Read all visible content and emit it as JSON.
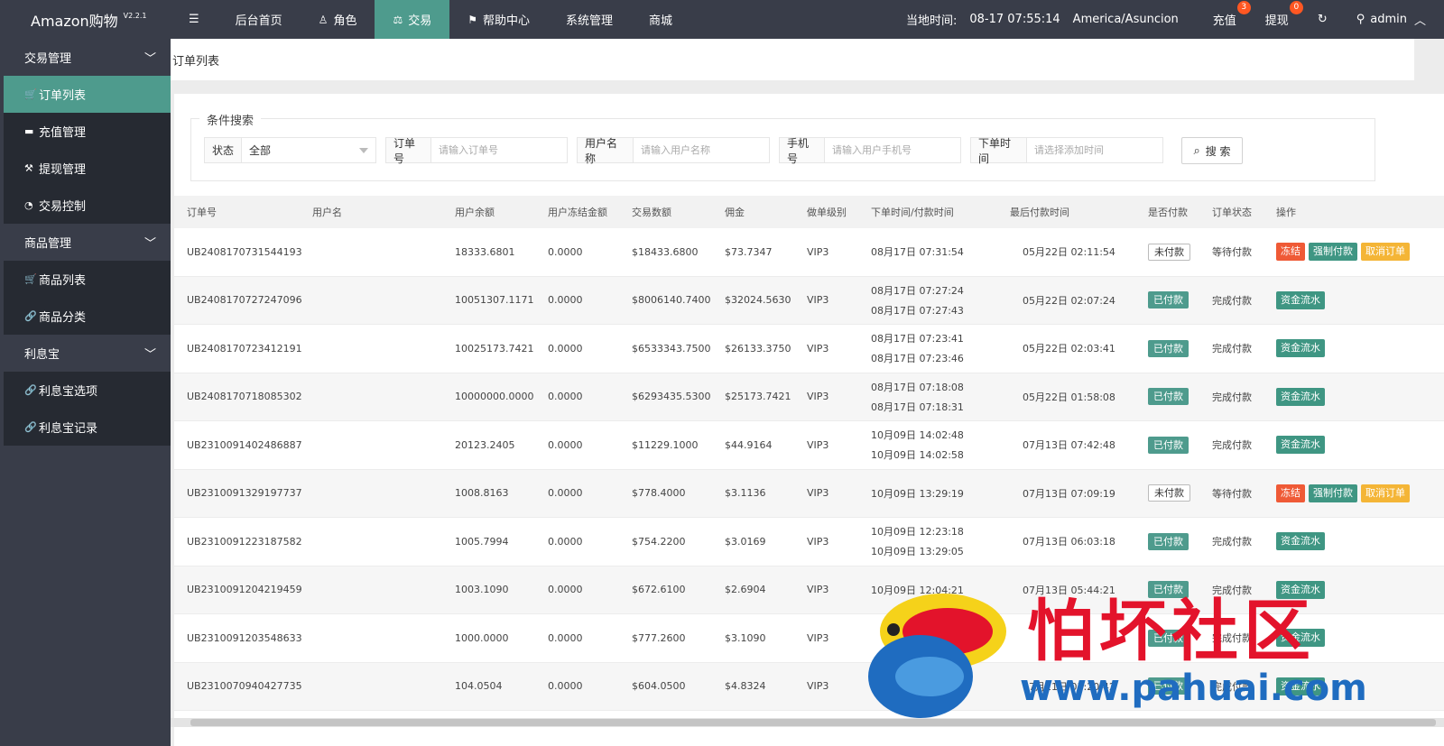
{
  "app": {
    "title": "Amazon购物",
    "version": "V2.2.1"
  },
  "nav": [
    {
      "label": "后台首页",
      "icon": "",
      "active": false
    },
    {
      "label": "角色",
      "icon": "user-icon",
      "active": false
    },
    {
      "label": "交易",
      "icon": "scale-icon",
      "active": true
    },
    {
      "label": "帮助中心",
      "icon": "flag-icon",
      "active": false
    },
    {
      "label": "系统管理",
      "icon": "",
      "active": false
    },
    {
      "label": "商城",
      "icon": "",
      "active": false
    }
  ],
  "topright": {
    "time_label": "当地时间:",
    "time_value": "08-17 07:55:14",
    "timezone": "America/Asuncion",
    "recharge_label": "充值",
    "recharge_badge": "3",
    "withdraw_label": "提现",
    "withdraw_badge": "0",
    "user_label": "admin"
  },
  "sidebar": [
    {
      "type": "group",
      "label": "交易管理"
    },
    {
      "type": "item",
      "label": "订单列表",
      "icon": "cart-icon",
      "active": true
    },
    {
      "type": "item",
      "label": "充值管理",
      "icon": "card-icon",
      "active": false
    },
    {
      "type": "item",
      "label": "提现管理",
      "icon": "gavel-icon",
      "active": false
    },
    {
      "type": "item",
      "label": "交易控制",
      "icon": "gauge-icon",
      "active": false
    },
    {
      "type": "group",
      "label": "商品管理"
    },
    {
      "type": "item",
      "label": "商品列表",
      "icon": "cart-icon",
      "active": false
    },
    {
      "type": "item",
      "label": "商品分类",
      "icon": "link-icon",
      "active": false
    },
    {
      "type": "group",
      "label": "利息宝"
    },
    {
      "type": "item",
      "label": "利息宝选项",
      "icon": "link-icon",
      "active": false
    },
    {
      "type": "item",
      "label": "利息宝记录",
      "icon": "link-icon",
      "active": false
    }
  ],
  "breadcrumb": "订单列表",
  "search": {
    "legend": "条件搜索",
    "status_label": "状态",
    "status_value": "全部",
    "order_label": "订单号",
    "order_placeholder": "请输入订单号",
    "user_label": "用户名称",
    "user_placeholder": "请输入用户名称",
    "phone_label": "手机号",
    "phone_placeholder": "请输入用户手机号",
    "time_label": "下单时间",
    "time_placeholder": "请选择添加时间",
    "button_label": "搜 索"
  },
  "table": {
    "headers": [
      "订单号",
      "用户名",
      "用户余额",
      "用户冻结金额",
      "交易数额",
      "佣金",
      "做单级别",
      "下单时间/付款时间",
      "最后付款时间",
      "是否付款",
      "订单状态",
      "操作"
    ],
    "rows": [
      {
        "order": "UB2408170731544193",
        "user": "",
        "balance": "18333.6801",
        "frozen": "0.0000",
        "amount": "$18433.6800",
        "commission": "$73.7347",
        "level": "VIP3",
        "time1": "08月17日 07:31:54",
        "time2": "",
        "last": "05月22日 02:11:54",
        "paid": "未付款",
        "paid_flag": false,
        "status": "等待付款",
        "actions": [
          "冻结",
          "强制付款",
          "取消订单"
        ]
      },
      {
        "order": "UB2408170727247096",
        "user": "",
        "balance": "10051307.1171",
        "frozen": "0.0000",
        "amount": "$8006140.7400",
        "commission": "$32024.5630",
        "level": "VIP3",
        "time1": "08月17日 07:27:24",
        "time2": "08月17日 07:27:43",
        "last": "05月22日 02:07:24",
        "paid": "已付款",
        "paid_flag": true,
        "status": "完成付款",
        "actions": [
          "资金流水"
        ]
      },
      {
        "order": "UB2408170723412191",
        "user": "",
        "balance": "10025173.7421",
        "frozen": "0.0000",
        "amount": "$6533343.7500",
        "commission": "$26133.3750",
        "level": "VIP3",
        "time1": "08月17日 07:23:41",
        "time2": "08月17日 07:23:46",
        "last": "05月22日 02:03:41",
        "paid": "已付款",
        "paid_flag": true,
        "status": "完成付款",
        "actions": [
          "资金流水"
        ]
      },
      {
        "order": "UB2408170718085302",
        "user": "",
        "balance": "10000000.0000",
        "frozen": "0.0000",
        "amount": "$6293435.5300",
        "commission": "$25173.7421",
        "level": "VIP3",
        "time1": "08月17日 07:18:08",
        "time2": "08月17日 07:18:31",
        "last": "05月22日 01:58:08",
        "paid": "已付款",
        "paid_flag": true,
        "status": "完成付款",
        "actions": [
          "资金流水"
        ]
      },
      {
        "order": "UB2310091402486887",
        "user": "",
        "balance": "20123.2405",
        "frozen": "0.0000",
        "amount": "$11229.1000",
        "commission": "$44.9164",
        "level": "VIP3",
        "time1": "10月09日 14:02:48",
        "time2": "10月09日 14:02:58",
        "last": "07月13日 07:42:48",
        "paid": "已付款",
        "paid_flag": true,
        "status": "完成付款",
        "actions": [
          "资金流水"
        ]
      },
      {
        "order": "UB2310091329197737",
        "user": "",
        "balance": "1008.8163",
        "frozen": "0.0000",
        "amount": "$778.4000",
        "commission": "$3.1136",
        "level": "VIP3",
        "time1": "10月09日 13:29:19",
        "time2": "",
        "last": "07月13日 07:09:19",
        "paid": "未付款",
        "paid_flag": false,
        "status": "等待付款",
        "actions": [
          "冻结",
          "强制付款",
          "取消订单"
        ]
      },
      {
        "order": "UB2310091223187582",
        "user": "",
        "balance": "1005.7994",
        "frozen": "0.0000",
        "amount": "$754.2200",
        "commission": "$3.0169",
        "level": "VIP3",
        "time1": "10月09日 12:23:18",
        "time2": "10月09日 13:29:05",
        "last": "07月13日 06:03:18",
        "paid": "已付款",
        "paid_flag": true,
        "status": "完成付款",
        "actions": [
          "资金流水"
        ]
      },
      {
        "order": "UB2310091204219459",
        "user": "",
        "balance": "1003.1090",
        "frozen": "0.0000",
        "amount": "$672.6100",
        "commission": "$2.6904",
        "level": "VIP3",
        "time1": "10月09日 12:04:21",
        "time2": "",
        "last": "07月13日 05:44:21",
        "paid": "已付款",
        "paid_flag": true,
        "status": "完成付款",
        "actions": [
          "资金流水"
        ]
      },
      {
        "order": "UB2310091203548633",
        "user": "",
        "balance": "1000.0000",
        "frozen": "0.0000",
        "amount": "$777.2600",
        "commission": "$3.1090",
        "level": "VIP3",
        "time1": "",
        "time2": "",
        "last": "",
        "paid": "已付款",
        "paid_flag": true,
        "status": "完成付款",
        "actions": [
          "资金流水"
        ]
      },
      {
        "order": "UB2310070940427735",
        "user": "",
        "balance": "104.0504",
        "frozen": "0.0000",
        "amount": "$604.0500",
        "commission": "$4.8324",
        "level": "VIP3",
        "time1": "",
        "time2": "",
        "last": "07月11日 03:20:42",
        "paid": "已付款",
        "paid_flag": true,
        "status": "完成付款",
        "actions": [
          "资金流水"
        ]
      }
    ]
  },
  "watermark": {
    "text": "怕坏社区",
    "url": "www.pahuai.com"
  }
}
